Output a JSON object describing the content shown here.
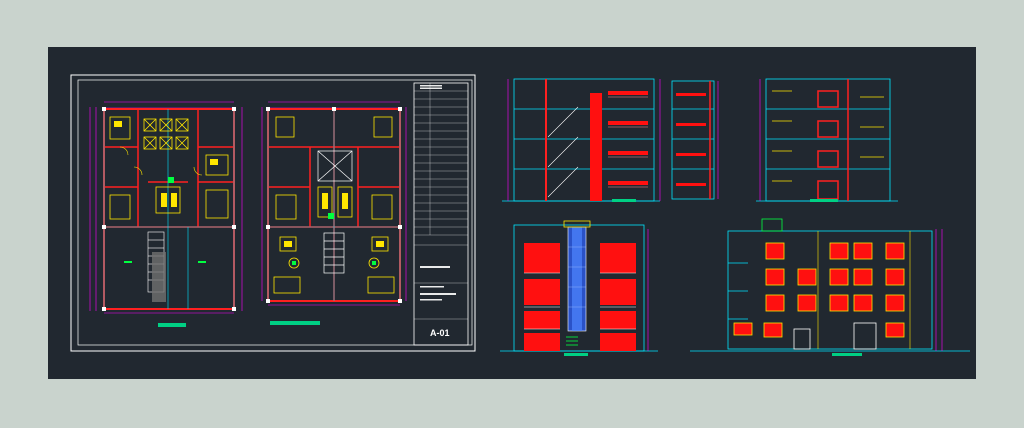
{
  "sheet": {
    "code": "A-01"
  },
  "colors": {
    "background": "#c9d3cd",
    "model_space": "#212830",
    "frame": "#ffffff",
    "wall": "#ff2020",
    "dimension": "#ff00ff",
    "axis": "#00e5ff",
    "furniture": "#ffe600",
    "green": "#00ff40",
    "glass": "#3b6cff",
    "label_bar": "#00d084"
  }
}
